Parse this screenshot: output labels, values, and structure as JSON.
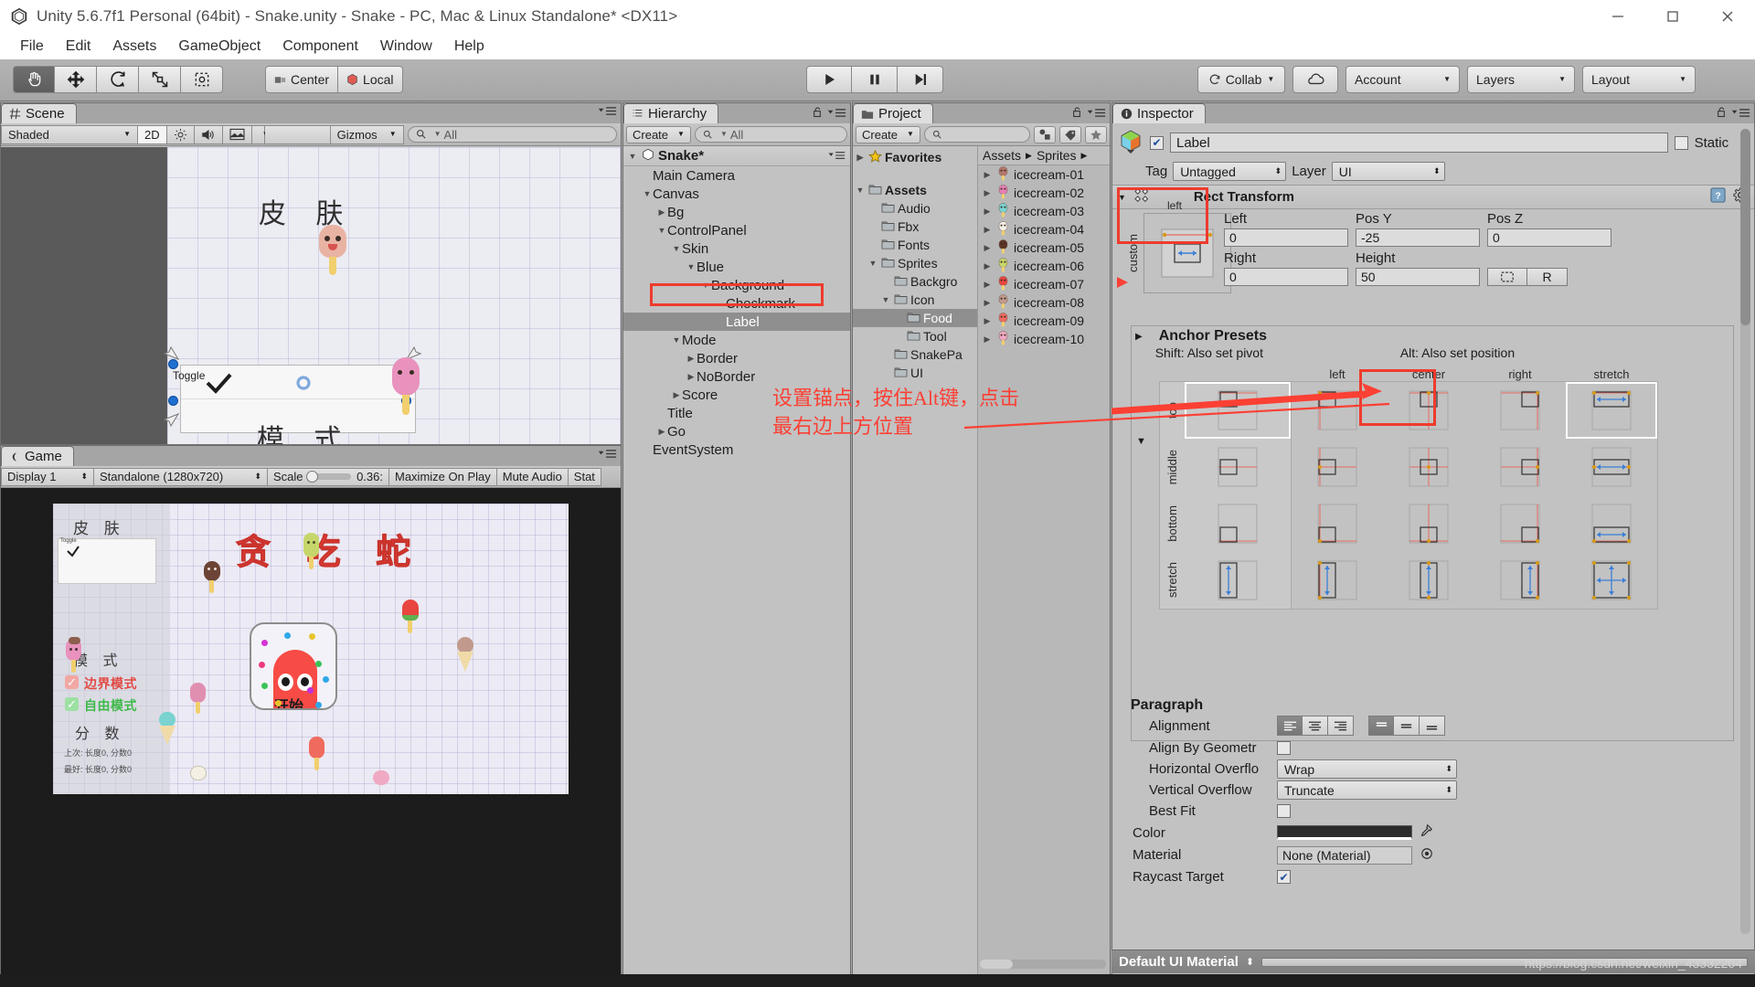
{
  "window": {
    "title": "Unity 5.6.7f1 Personal (64bit) - Snake.unity - Snake - PC, Mac & Linux Standalone* <DX11>",
    "logo_icon": "unity-logo-icon",
    "minimize_icon": "minimize-icon",
    "maximize_icon": "maximize-icon",
    "close_icon": "close-icon"
  },
  "menubar": [
    "File",
    "Edit",
    "Assets",
    "GameObject",
    "Component",
    "Window",
    "Help"
  ],
  "toolbar": {
    "transform_tools": [
      {
        "name": "hand-tool",
        "icon": "hand-icon",
        "active": true
      },
      {
        "name": "move-tool",
        "icon": "move-arrows-icon",
        "active": false
      },
      {
        "name": "rotate-tool",
        "icon": "rotate-icon",
        "active": false
      },
      {
        "name": "scale-tool",
        "icon": "scale-icon",
        "active": false
      },
      {
        "name": "rect-tool",
        "icon": "rect-transform-icon",
        "active": false
      }
    ],
    "pivot_mode": "Center",
    "pivot_rotation": "Local",
    "play_btn": "play-icon",
    "pause_btn": "pause-icon",
    "step_btn": "step-icon",
    "collab": "Collab",
    "cloud_icon": "cloud-icon",
    "account": "Account",
    "layers": "Layers",
    "layout": "Layout"
  },
  "scene": {
    "tab": "Scene",
    "tab_icon": "scene-grid-icon",
    "shading": "Shaded",
    "mode_2d": "2D",
    "lighting_icon": "sun-icon",
    "audio_icon": "speaker-icon",
    "fx_icon": "image-icon",
    "gizmos": "Gizmos",
    "search_placeholder": "All",
    "search_icon": "search-icon",
    "canvas_texts": [
      {
        "text": "皮 肤",
        "name": "scene-skin-title"
      },
      {
        "text": "Toggle",
        "name": "scene-toggle-label"
      },
      {
        "text": "模 式",
        "name": "scene-mode-title"
      }
    ]
  },
  "game": {
    "tab": "Game",
    "tab_icon": "game-controller-icon",
    "display": "Display 1",
    "resolution": "Standalone (1280x720)",
    "scale_label": "Scale",
    "scale_value": "0.36:",
    "maximize": "Maximize On Play",
    "mute": "Mute Audio",
    "stats": "Stat",
    "title_cn": "贪 吃 蛇",
    "skin_title": "皮 肤",
    "toggle_label": "Toggle",
    "mode_title": "模 式",
    "mode_options": [
      {
        "label": "边界模式",
        "color": "#e24a43",
        "box": "#f2a7a3",
        "checked": true
      },
      {
        "label": "自由模式",
        "color": "#3fba4a",
        "box": "#9ee0a3",
        "checked": true
      }
    ],
    "score_title": "分 数",
    "score_lines": [
      "上次: 长度0, 分数0",
      "最好: 长度0, 分数0"
    ],
    "start_button": "开始"
  },
  "hierarchy": {
    "tab": "Hierarchy",
    "tab_icon": "hierarchy-list-icon",
    "lock_icon": "lock-open-icon",
    "menu_icon": "panel-menu-icon",
    "create": "Create",
    "search_placeholder": "All",
    "search_icon": "search-icon",
    "root": "Snake*",
    "root_icon": "unity-scene-icon",
    "nodes": [
      {
        "label": "Main Camera",
        "depth": 1,
        "arrow": "none",
        "selected": false
      },
      {
        "label": "Canvas",
        "depth": 1,
        "arrow": "open",
        "selected": false
      },
      {
        "label": "Bg",
        "depth": 2,
        "arrow": "closed",
        "selected": false
      },
      {
        "label": "ControlPanel",
        "depth": 2,
        "arrow": "open",
        "selected": false
      },
      {
        "label": "Skin",
        "depth": 3,
        "arrow": "open",
        "selected": false
      },
      {
        "label": "Blue",
        "depth": 4,
        "arrow": "open",
        "selected": false
      },
      {
        "label": "Background",
        "depth": 5,
        "arrow": "open",
        "selected": false
      },
      {
        "label": "Checkmark",
        "depth": 6,
        "arrow": "none",
        "selected": false
      },
      {
        "label": "Label",
        "depth": 6,
        "arrow": "none",
        "selected": true
      },
      {
        "label": "Mode",
        "depth": 3,
        "arrow": "open",
        "selected": false
      },
      {
        "label": "Border",
        "depth": 4,
        "arrow": "closed",
        "selected": false
      },
      {
        "label": "NoBorder",
        "depth": 4,
        "arrow": "closed",
        "selected": false
      },
      {
        "label": "Score",
        "depth": 3,
        "arrow": "closed",
        "selected": false
      },
      {
        "label": "Title",
        "depth": 2,
        "arrow": "none",
        "selected": false
      },
      {
        "label": "Go",
        "depth": 2,
        "arrow": "closed",
        "selected": false
      },
      {
        "label": "EventSystem",
        "depth": 1,
        "arrow": "none",
        "selected": false
      }
    ]
  },
  "project": {
    "tab": "Project",
    "tab_icon": "folder-icon",
    "lock_icon": "lock-open-icon",
    "create": "Create",
    "search_placeholder": "",
    "search_icon": "search-icon",
    "filter_type_icon": "filter-type-icon",
    "filter_label_icon": "filter-label-icon",
    "favorite_icon": "star-icon",
    "favorites": "Favorites",
    "tree": [
      {
        "label": "Assets",
        "depth": 0,
        "arrow": "open",
        "bold": true,
        "selected": false
      },
      {
        "label": "Audio",
        "depth": 1,
        "arrow": "none",
        "bold": false,
        "selected": false
      },
      {
        "label": "Fbx",
        "depth": 1,
        "arrow": "none",
        "bold": false,
        "selected": false
      },
      {
        "label": "Fonts",
        "depth": 1,
        "arrow": "none",
        "bold": false,
        "selected": false
      },
      {
        "label": "Sprites",
        "depth": 1,
        "arrow": "open",
        "bold": false,
        "selected": false
      },
      {
        "label": "Backgro",
        "depth": 2,
        "arrow": "none",
        "bold": false,
        "selected": false
      },
      {
        "label": "Icon",
        "depth": 2,
        "arrow": "open",
        "bold": false,
        "selected": false
      },
      {
        "label": "Food",
        "depth": 3,
        "arrow": "none",
        "bold": false,
        "selected": true
      },
      {
        "label": "Tool",
        "depth": 3,
        "arrow": "none",
        "bold": false,
        "selected": false
      },
      {
        "label": "SnakePa",
        "depth": 2,
        "arrow": "none",
        "bold": false,
        "selected": false
      },
      {
        "label": "UI",
        "depth": 2,
        "arrow": "none",
        "bold": false,
        "selected": false
      }
    ],
    "breadcrumb": [
      "Assets",
      "Sprites"
    ],
    "assets": [
      {
        "label": "icecream-01",
        "color": "#b5786a"
      },
      {
        "label": "icecream-02",
        "color": "#e87fb5"
      },
      {
        "label": "icecream-03",
        "color": "#7ad3d0"
      },
      {
        "label": "icecream-04",
        "color": "#f2f0e6"
      },
      {
        "label": "icecream-05",
        "color": "#5d3526"
      },
      {
        "label": "icecream-06",
        "color": "#c6d66b"
      },
      {
        "label": "icecream-07",
        "color": "#e8453f"
      },
      {
        "label": "icecream-08",
        "color": "#c19a8c"
      },
      {
        "label": "icecream-09",
        "color": "#ef6b5e"
      },
      {
        "label": "icecream-10",
        "color": "#f0a9c2"
      }
    ]
  },
  "inspector": {
    "tab": "Inspector",
    "tab_icon": "info-icon",
    "lock_icon": "lock-open-icon",
    "enabled_checkbox": true,
    "object_name": "Label",
    "static_label": "Static",
    "tag_label": "Tag",
    "tag_value": "Untagged",
    "layer_label": "Layer",
    "layer_value": "UI",
    "component": "Rect Transform",
    "help_icon": "help-book-icon",
    "gear_icon": "gear-icon",
    "anchor_preview_label": "custom",
    "anchor_preview_top_label": "left",
    "rect_fields": [
      {
        "label": "Left",
        "value": "0"
      },
      {
        "label": "Pos Y",
        "value": "-25"
      },
      {
        "label": "Pos Z",
        "value": "0"
      },
      {
        "label": "Right",
        "value": "0"
      },
      {
        "label": "Height",
        "value": "50"
      }
    ],
    "blueprint_icon": "blueprint-icon",
    "raw_toggle": "R",
    "anchor_presets": {
      "title": "Anchor Presets",
      "hint_shift": "Shift: Also set pivot",
      "hint_alt": "Alt: Also set position",
      "columns": [
        "left",
        "center",
        "right",
        "stretch"
      ],
      "rows": [
        "top",
        "middle",
        "bottom",
        "stretch"
      ],
      "selected_col": "stretch",
      "selected_row": "top"
    },
    "paragraph": {
      "section": "Paragraph",
      "alignment_label": "Alignment",
      "h_align_selected": 0,
      "v_align_selected": 0,
      "align_by_geometry_label": "Align By Geometr",
      "align_by_geometry": false,
      "horizontal_overflow_label": "Horizontal Overflo",
      "horizontal_overflow": "Wrap",
      "vertical_overflow_label": "Vertical Overflow",
      "vertical_overflow": "Truncate",
      "best_fit_label": "Best Fit",
      "best_fit": false,
      "color_label": "Color",
      "color_value": "#2b2b2b",
      "material_label": "Material",
      "material_value": "None (Material)",
      "material_picker_icon": "target-circle-icon",
      "raycast_label": "Raycast Target",
      "raycast_target": true,
      "eyedropper_icon": "eyedropper-icon"
    },
    "footer_material": "Default UI Material"
  },
  "annotation": {
    "line1": "设置锚点，按住Alt键，点击",
    "line2": "最右边上方位置",
    "color": "#fb4034"
  },
  "watermark": "https://blog.csdn.net/weixin_43332204"
}
